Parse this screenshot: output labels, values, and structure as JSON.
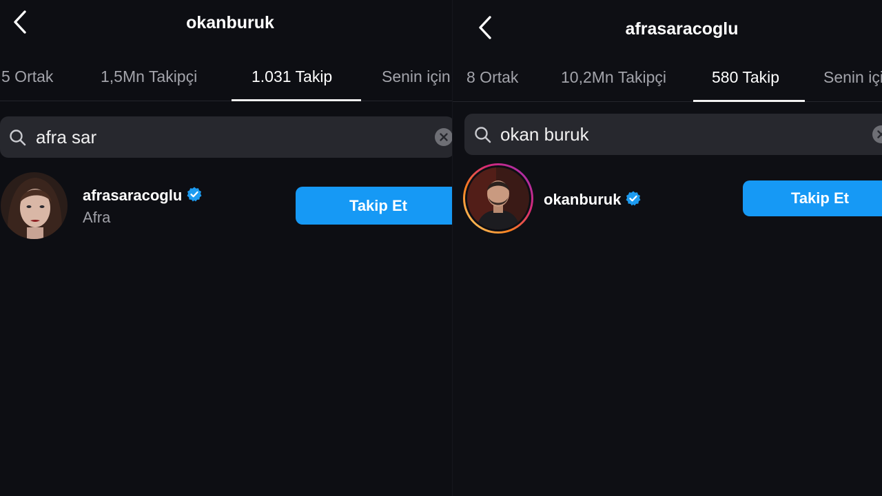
{
  "left": {
    "title": "okanburuk",
    "tabs": [
      {
        "label": "5 Ortak"
      },
      {
        "label": "1,5Mn Takipçi"
      },
      {
        "label": "1.031 Takip",
        "active": true
      },
      {
        "label": "Senin için"
      }
    ],
    "search": {
      "value": "afra sar"
    },
    "result": {
      "username": "afrasaracoglu",
      "full_name": "Afra",
      "verified": true,
      "follow_label": "Takip Et"
    }
  },
  "right": {
    "title": "afrasaracoglu",
    "tabs": [
      {
        "label": "8 Ortak"
      },
      {
        "label": "10,2Mn Takipçi"
      },
      {
        "label": "580 Takip",
        "active": true
      },
      {
        "label": "Senin için"
      }
    ],
    "search": {
      "value": "okan buruk"
    },
    "result": {
      "username": "okanburuk",
      "verified": true,
      "has_story_ring": true,
      "follow_label": "Takip Et"
    }
  },
  "colors": {
    "background": "#0e0f14",
    "search_bg": "#27282e",
    "follow_button": "#1699f5",
    "verified_badge": "#1d9bf0",
    "inactive_tab": "#a3a4ab"
  },
  "icons": [
    "back-chevron-icon",
    "search-icon",
    "clear-icon",
    "verified-badge-icon"
  ]
}
